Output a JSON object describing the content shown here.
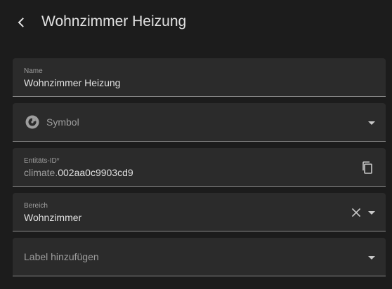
{
  "header": {
    "title": "Wohnzimmer Heizung"
  },
  "fields": {
    "name": {
      "label": "Name",
      "value": "Wohnzimmer Heizung"
    },
    "symbol": {
      "placeholder": "Symbol",
      "icon": "thermostat-dial-icon"
    },
    "entity_id": {
      "label": "Entitäts-ID*",
      "prefix": "climate.",
      "value": "002aa0c9903cd9"
    },
    "area": {
      "label": "Bereich",
      "value": "Wohnzimmer"
    },
    "labels": {
      "placeholder": "Label hinzufügen"
    }
  },
  "colors": {
    "background": "#1c1c1c",
    "field_background": "#2b2b2b",
    "text": "#e1e1e1",
    "secondary_text": "#9e9e9e"
  }
}
